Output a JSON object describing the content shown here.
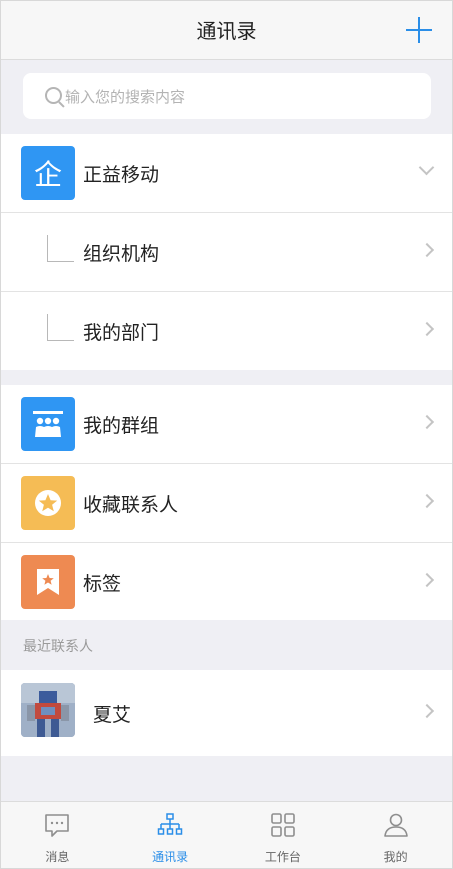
{
  "header": {
    "title": "通讯录"
  },
  "search": {
    "placeholder": "输入您的搜索内容"
  },
  "org": {
    "name": "正益移动",
    "icon_char": "企",
    "children": [
      {
        "label": "组织机构"
      },
      {
        "label": "我的部门"
      }
    ]
  },
  "groups": [
    {
      "label": "我的群组",
      "icon": "group-icon",
      "color": "#2f96f3"
    },
    {
      "label": "收藏联系人",
      "icon": "star-icon",
      "color": "#f5bc55"
    },
    {
      "label": "标签",
      "icon": "tag-icon",
      "color": "#ee8a52"
    }
  ],
  "recent": {
    "header": "最近联系人",
    "contacts": [
      {
        "name": "夏艾",
        "icon": "avatar-image"
      }
    ]
  },
  "tabs": [
    {
      "label": "消息",
      "icon": "message-icon"
    },
    {
      "label": "通讯录",
      "icon": "org-chart-icon",
      "active": true
    },
    {
      "label": "工作台",
      "icon": "grid-icon"
    },
    {
      "label": "我的",
      "icon": "user-icon"
    }
  ],
  "colors": {
    "accent": "#2a8ee8",
    "background": "#efeff4"
  }
}
